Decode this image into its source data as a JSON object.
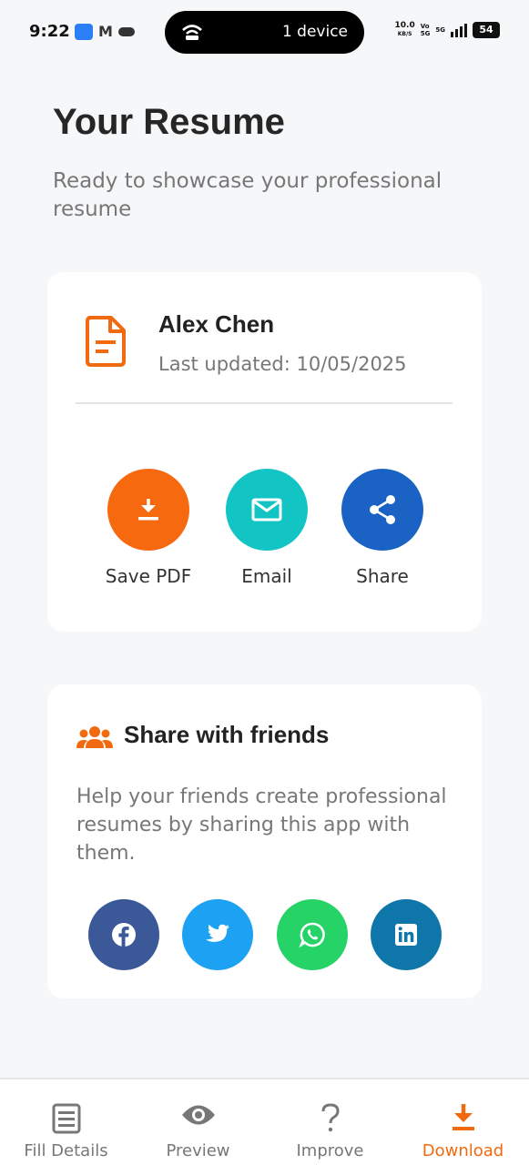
{
  "status_bar": {
    "time": "9:22",
    "pill_text": "1 device",
    "net_speed_value": "10.0",
    "net_speed_unit": "KB/S",
    "volte_top": "Vo",
    "volte_bottom": "5G",
    "network": "5G",
    "battery": "54"
  },
  "header": {
    "title": "Your Resume",
    "subtitle": "Ready to showcase your professional resume"
  },
  "resume_card": {
    "name": "Alex Chen",
    "last_updated": "Last updated: 10/05/2025",
    "actions": [
      {
        "label": "Save PDF",
        "icon": "download-icon",
        "color": "#f7690f"
      },
      {
        "label": "Email",
        "icon": "mail-icon",
        "color": "#13c4c4"
      },
      {
        "label": "Share",
        "icon": "share-icon",
        "color": "#1a62c4"
      }
    ]
  },
  "share_card": {
    "title": "Share with friends",
    "description": "Help your friends create professional resumes by sharing this app with them.",
    "socials": [
      {
        "name": "facebook-icon",
        "color": "#3b5998"
      },
      {
        "name": "twitter-icon",
        "color": "#1da1f2"
      },
      {
        "name": "whatsapp-icon",
        "color": "#25d366"
      },
      {
        "name": "linkedin-icon",
        "color": "#0e76a8"
      }
    ]
  },
  "bottom_nav": {
    "items": [
      {
        "label": "Fill Details",
        "icon": "form-icon"
      },
      {
        "label": "Preview",
        "icon": "eye-icon"
      },
      {
        "label": "Improve",
        "icon": "question-icon"
      },
      {
        "label": "Download",
        "icon": "download-icon"
      }
    ],
    "active_index": 3
  },
  "colors": {
    "accent": "#f26a10",
    "background": "#f6f7f9"
  }
}
